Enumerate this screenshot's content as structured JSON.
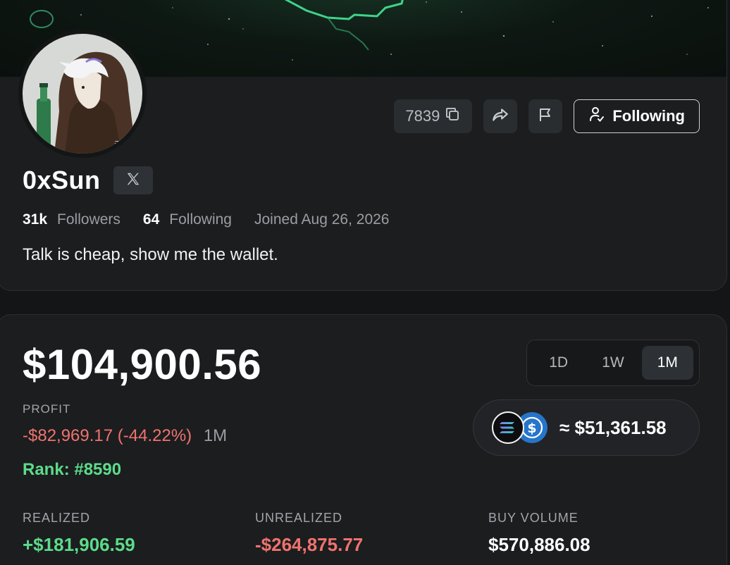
{
  "profile": {
    "code": "7839",
    "follow_label": "Following",
    "username": "0xSun",
    "followers_count": "31k",
    "followers_label": "Followers",
    "following_count": "64",
    "following_label": "Following",
    "joined": "Joined Aug 26, 2026",
    "bio": "Talk is cheap, show me the wallet.",
    "icons": [
      "copy-icon",
      "share-icon",
      "flag-icon",
      "user-check-icon",
      "x-logo-icon"
    ]
  },
  "portfolio": {
    "balance": "$104,900.56",
    "profit_label": "PROFIT",
    "profit_value": "-$82,969.17 (-44.22%)",
    "profit_period": "1M",
    "rank": "Rank: #8590",
    "periods": [
      {
        "label": "1D",
        "active": false
      },
      {
        "label": "1W",
        "active": false
      },
      {
        "label": "1M",
        "active": true
      }
    ],
    "token_value": "≈ $51,361.58",
    "token_icons": [
      "solana-icon",
      "usdc-icon"
    ],
    "metrics": [
      {
        "label": "REALIZED",
        "value": "+$181,906.59",
        "tone": "pos"
      },
      {
        "label": "UNREALIZED",
        "value": "-$264,875.77",
        "tone": "neg"
      },
      {
        "label": "BUY VOLUME",
        "value": "$570,886.08",
        "tone": "neutral"
      }
    ]
  },
  "colors": {
    "positive": "#5ddb8a",
    "negative": "#f0736e",
    "background": "#141517",
    "card": "#1b1d1f"
  }
}
